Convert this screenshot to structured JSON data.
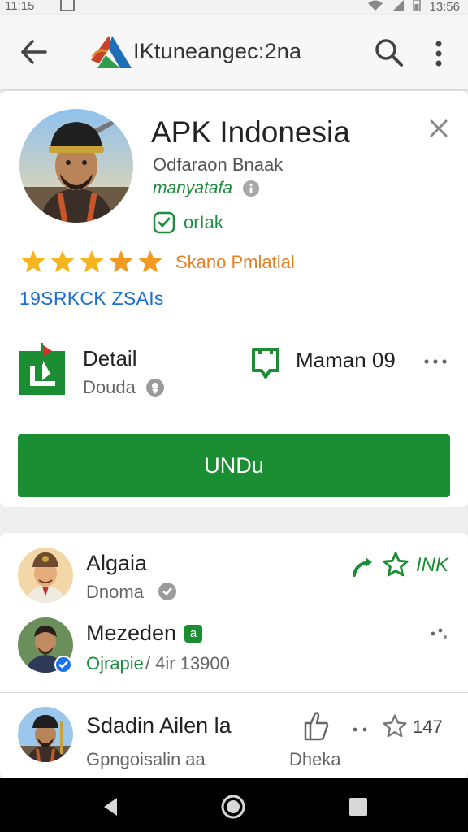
{
  "status_bar": {
    "time": "11:15",
    "clock": "13:56",
    "icons": [
      "image-icon",
      "wifi-icon",
      "signal-icon",
      "battery-icon"
    ]
  },
  "app_bar": {
    "title": "IKtuneangec:2na",
    "icons": [
      "back-arrow-icon",
      "app-logo",
      "search-icon",
      "overflow-menu-icon"
    ]
  },
  "app": {
    "title": "APK Indonesia",
    "developer": "Odfaraon Bnaak",
    "category": "manyatafa",
    "badge": "orIak",
    "rating_text": "Skano Pmlatial",
    "rating_stars": 5,
    "downloads": "19SRKCK ZSAIs",
    "detail_label": "Detail",
    "detail_sub": "Douda",
    "maman_label": "Maman 09",
    "install_label": "UNDu"
  },
  "reviews": [
    {
      "name": "Algaia",
      "sub": "Dnoma",
      "action_text": "INK"
    },
    {
      "name": "Mezeden",
      "badge": "a",
      "sub_green": "Ojrapie",
      "sub_grey": "/ 4ir 13900"
    },
    {
      "name": "Sdadin Ailen la",
      "sub": "Gpngoisalin aa",
      "action_label": "Dheka",
      "count": "147"
    }
  ],
  "colors": {
    "primary_green": "#1b8e34",
    "star_orange": "#f5a623",
    "link_blue": "#1a6fd1",
    "rating_orange": "#e0822a"
  }
}
